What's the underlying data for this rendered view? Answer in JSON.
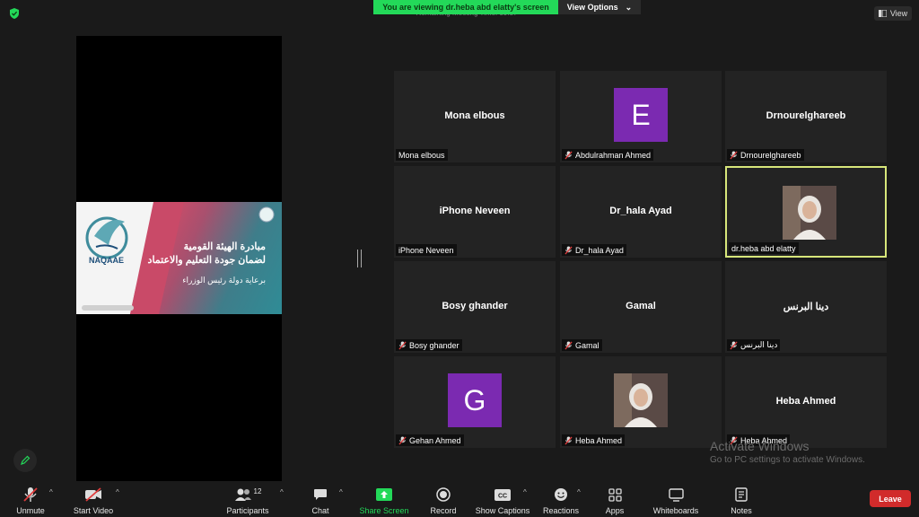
{
  "banner": {
    "text": "You are viewing dr.heba abd elatty's screen",
    "options_label": "View Options",
    "caret": "⌄",
    "timer_text": "Remaining Meeting Time: 39:57"
  },
  "view_button": {
    "label": "View"
  },
  "slide": {
    "line1": "مبادرة الهيئة القومية",
    "line2": "لضمان جودة التعليم والاعتماد",
    "line3": "برعاية دولة رئيس الوزراء",
    "logo_text": "NAQAAE"
  },
  "tiles": [
    {
      "center": "Mona elbous",
      "label": "Mona elbous",
      "muted": false,
      "kind": "name"
    },
    {
      "center": "E",
      "label": "Abdulrahman Ahmed",
      "muted": true,
      "kind": "letter"
    },
    {
      "center": "Drnourelghareeb",
      "label": "Drnourelghareeb",
      "muted": true,
      "kind": "name"
    },
    {
      "center": "iPhone Neveen",
      "label": "iPhone Neveen",
      "muted": false,
      "kind": "name"
    },
    {
      "center": "Dr_hala Ayad",
      "label": "Dr_hala Ayad",
      "muted": true,
      "kind": "name"
    },
    {
      "center": "",
      "label": "dr.heba abd elatty",
      "muted": false,
      "kind": "photo"
    },
    {
      "center": "Bosy ghander",
      "label": "Bosy ghander",
      "muted": true,
      "kind": "name"
    },
    {
      "center": "Gamal",
      "label": "Gamal",
      "muted": true,
      "kind": "name"
    },
    {
      "center": "دينا البرنس",
      "label": "دينا البرنس",
      "muted": true,
      "kind": "name"
    },
    {
      "center": "G",
      "label": "Gehan Ahmed",
      "muted": true,
      "kind": "letter"
    },
    {
      "center": "",
      "label": "Heba Ahmed",
      "muted": true,
      "kind": "photo"
    },
    {
      "center": "Heba Ahmed",
      "label": "Heba Ahmed",
      "muted": true,
      "kind": "name"
    }
  ],
  "watermark": {
    "title": "Activate Windows",
    "subtitle": "Go to PC settings to activate Windows."
  },
  "toolbar": {
    "unmute": "Unmute",
    "start_video": "Start Video",
    "participants": "Participants",
    "participants_count": "12",
    "chat": "Chat",
    "share_screen": "Share Screen",
    "record": "Record",
    "show_captions": "Show Captions",
    "reactions": "Reactions",
    "apps": "Apps",
    "whiteboards": "Whiteboards",
    "notes": "Notes",
    "leave": "Leave",
    "caret": "^"
  },
  "colors": {
    "green": "#23d959",
    "purple": "#7b2ab1",
    "active_border": "#d7e67a",
    "leave": "#d12b2b"
  }
}
